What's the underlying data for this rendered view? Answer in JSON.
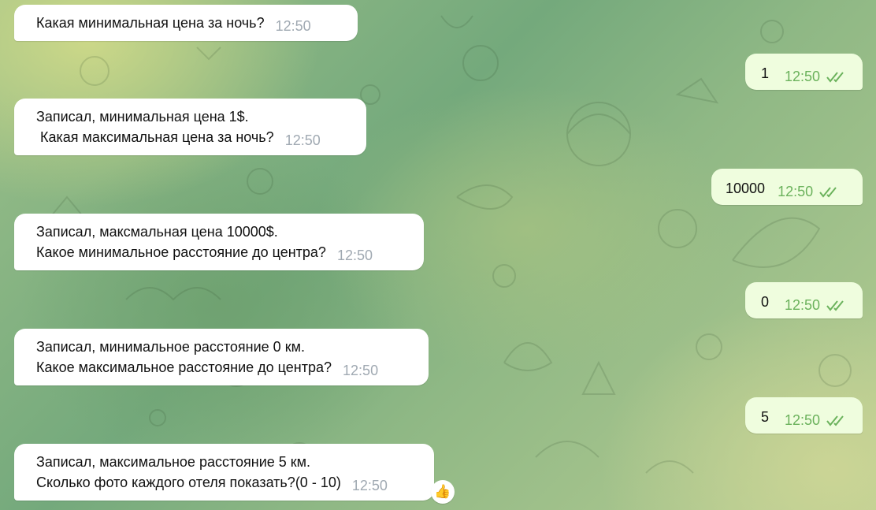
{
  "chat": {
    "messages": [
      {
        "direction": "in",
        "text": "Какая минимальная цена за ночь?",
        "time": "12:50"
      },
      {
        "direction": "out",
        "text": "1",
        "time": "12:50",
        "status": "read"
      },
      {
        "direction": "in",
        "text": "Записал, минимальная цена 1$.\n Какая максимальная цена за ночь?",
        "time": "12:50"
      },
      {
        "direction": "out",
        "text": "10000",
        "time": "12:50",
        "status": "read"
      },
      {
        "direction": "in",
        "text": "Записал, максмальная цена 10000$.\nКакое минимальное расстояние до центра?",
        "time": "12:50"
      },
      {
        "direction": "out",
        "text": "0",
        "time": "12:50",
        "status": "read"
      },
      {
        "direction": "in",
        "text": "Записал, минимальное расстояние 0 км.\nКакое максимальное расстояние до центра?",
        "time": "12:50"
      },
      {
        "direction": "out",
        "text": "5",
        "time": "12:50",
        "status": "read"
      },
      {
        "direction": "in",
        "text": "Записал, максимальное расстояние 5 км.\nСколько фото каждого отеля показать?(0 - 10)",
        "time": "12:50",
        "reaction": "👍"
      }
    ]
  },
  "colors": {
    "incoming_bubble": "#ffffff",
    "outgoing_bubble": "#effdde",
    "outgoing_time": "#6bb25c",
    "incoming_time": "#a0a9b2",
    "read_checks": "#6bb25c"
  },
  "icons": {
    "read_status": "double-check-icon",
    "reaction": "thumbs-up-icon"
  }
}
